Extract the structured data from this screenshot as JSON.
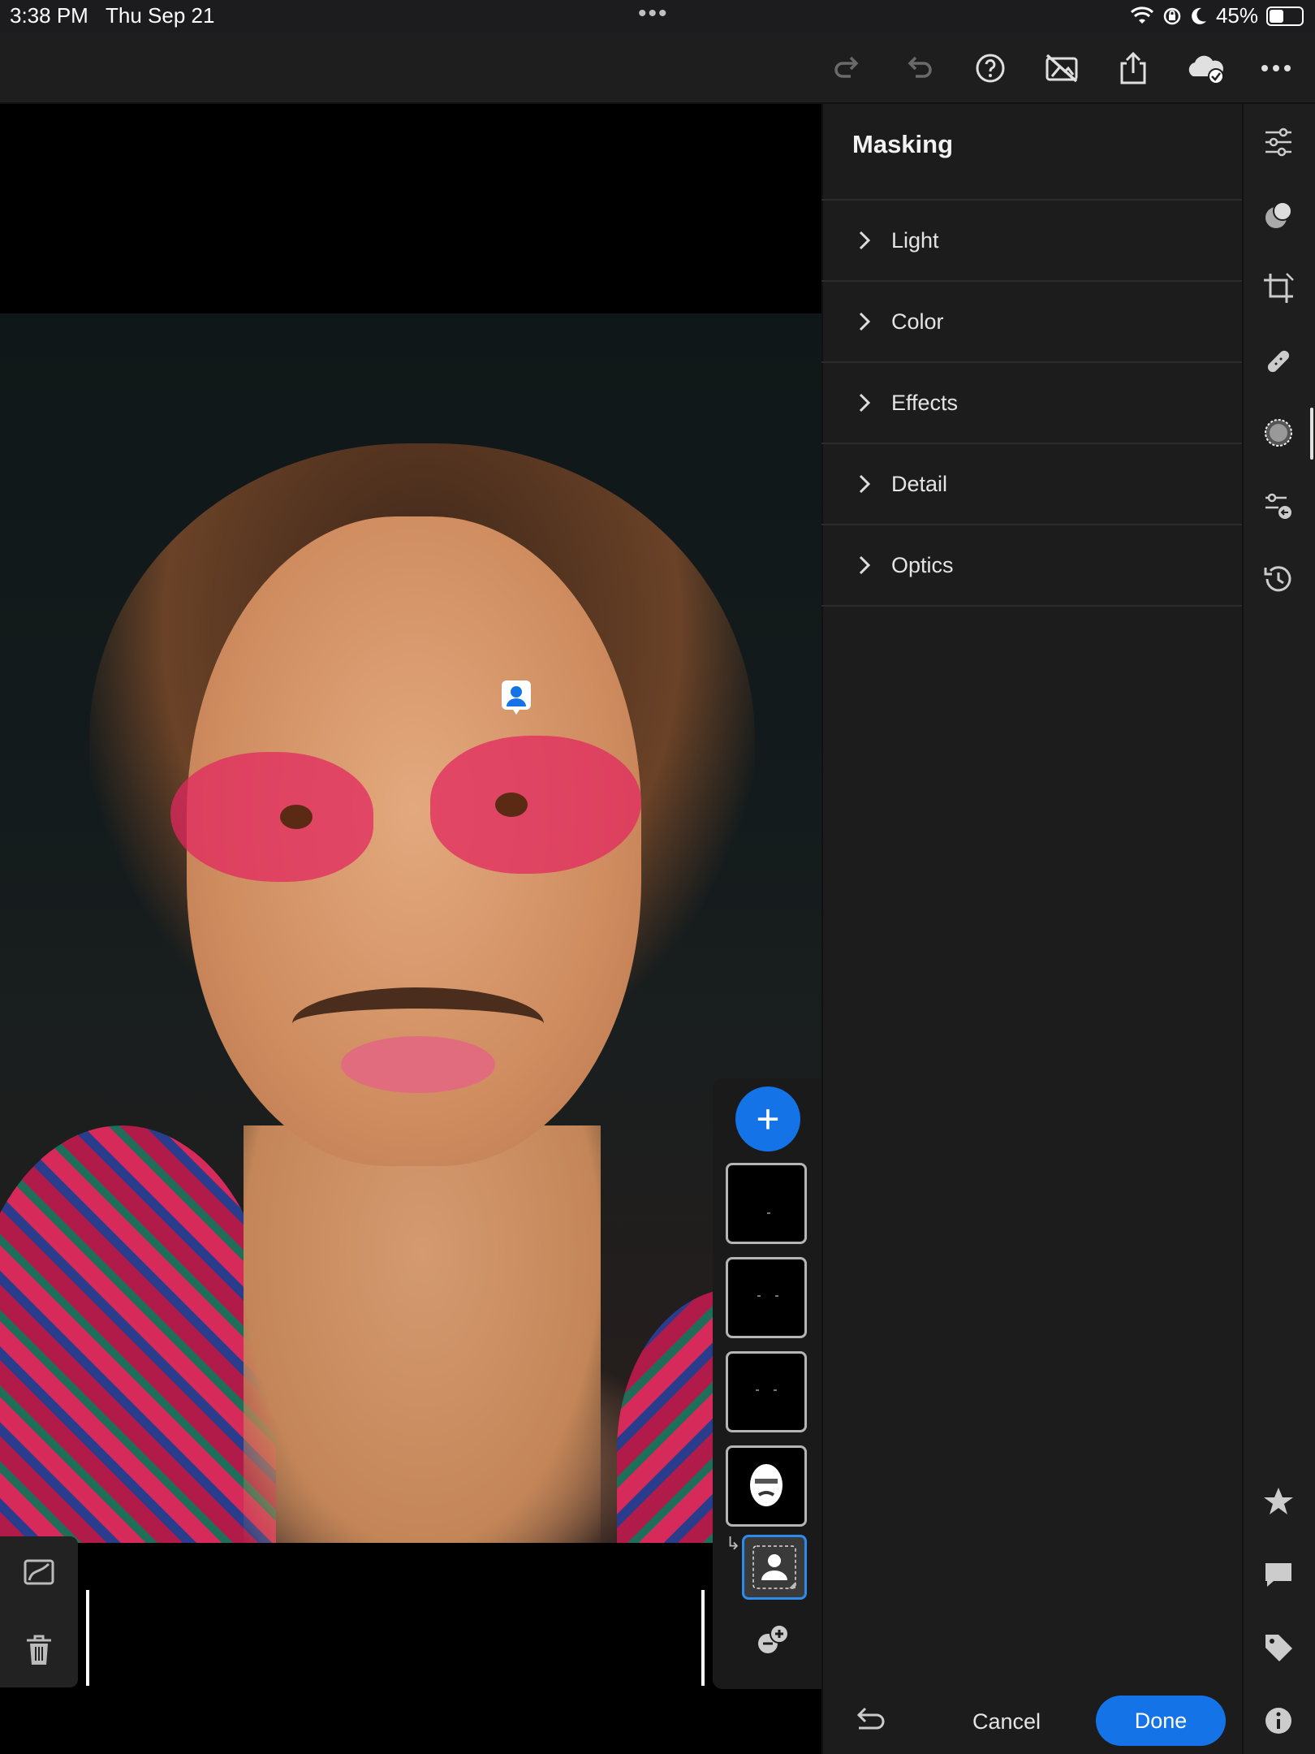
{
  "status_bar": {
    "time": "3:38 PM",
    "date": "Thu Sep 21",
    "dots": "•••",
    "battery_text": "45%",
    "battery_level": 0.45
  },
  "toolbar": {
    "icons": [
      "redo-icon",
      "undo-icon",
      "help-icon",
      "hide-mask-overlay-icon",
      "share-icon",
      "cloud-synced-icon",
      "more-icon"
    ]
  },
  "panel": {
    "title": "Masking",
    "sections": [
      {
        "label": "Light"
      },
      {
        "label": "Color"
      },
      {
        "label": "Effects"
      },
      {
        "label": "Detail"
      },
      {
        "label": "Optics"
      }
    ],
    "cancel_label": "Cancel",
    "done_label": "Done"
  },
  "mask_strip": {
    "add_label": "+",
    "mask_count": 4,
    "selected_submask": "select-subject"
  },
  "rail": {
    "icons": [
      "edit-sliders-icon",
      "selective-adjust-icon",
      "crop-icon",
      "healing-icon",
      "masking-icon",
      "presets-icon",
      "versions-icon",
      "rating-star-icon",
      "comment-icon",
      "keyword-tag-icon",
      "info-icon"
    ]
  },
  "colors": {
    "accent": "#1473e6",
    "panel_bg": "#1c1c1c",
    "canvas_bg": "#000000",
    "toolbar_bg": "#1e1e1e"
  }
}
